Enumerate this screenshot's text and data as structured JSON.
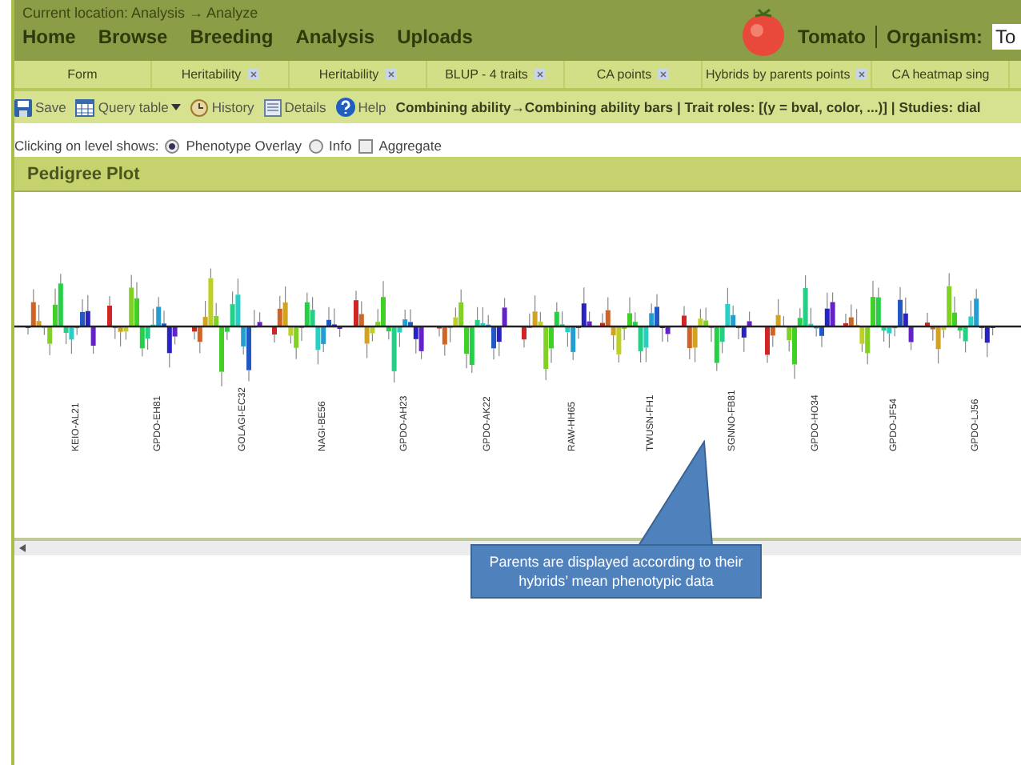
{
  "header": {
    "location": "Current location: Analysis → Analyze",
    "nav": [
      "Home",
      "Browse",
      "Breeding",
      "Analysis",
      "Uploads"
    ],
    "organism_name": "Tomato",
    "organism_label": "Organism:",
    "organism_value": "To"
  },
  "tabs": [
    {
      "label": "Form",
      "closable": false
    },
    {
      "label": "Heritability",
      "closable": true
    },
    {
      "label": "Heritability",
      "closable": true
    },
    {
      "label": "BLUP - 4 traits",
      "closable": true
    },
    {
      "label": "CA points",
      "closable": true
    },
    {
      "label": "Hybrids by parents points",
      "closable": true
    },
    {
      "label": "CA heatmap sing",
      "closable": false
    }
  ],
  "toolbar": {
    "buttons": [
      {
        "label": "Save",
        "kind": "save",
        "dropdown": false
      },
      {
        "label": "Query table",
        "kind": "table",
        "dropdown": true
      },
      {
        "label": "History",
        "kind": "history",
        "dropdown": false
      },
      {
        "label": "Details",
        "kind": "details",
        "dropdown": false
      },
      {
        "label": "Help",
        "kind": "help",
        "dropdown": false
      }
    ],
    "breadcrumb": "Combining ability→Combining ability bars | Trait roles: [(y = bval, color, ...)] | Studies: dial"
  },
  "options": {
    "label": "Clicking on level shows:",
    "choices": [
      {
        "label": "Phenotype Overlay",
        "kind": "radio",
        "selected": true
      },
      {
        "label": "Info",
        "kind": "radio",
        "selected": false
      },
      {
        "label": "Aggregate",
        "kind": "checkbox",
        "selected": false
      }
    ]
  },
  "panel": {
    "title": "Pedigree Plot",
    "parent_labels": [
      "KEIO-AL21",
      "GPDO-EH81",
      "GOLAGI-EC32",
      "NAGI-BE56",
      "GPDO-AH23",
      "GPDO-AK22",
      "RAW-HH65",
      "TWUSN-FH1",
      "SGNNO-FB81",
      "GPDO-HO34",
      "GPDO-JF54",
      "GPDO-LJ56"
    ]
  },
  "callout": "Parents are displayed according to their hybrids’ mean phenotypic data"
}
